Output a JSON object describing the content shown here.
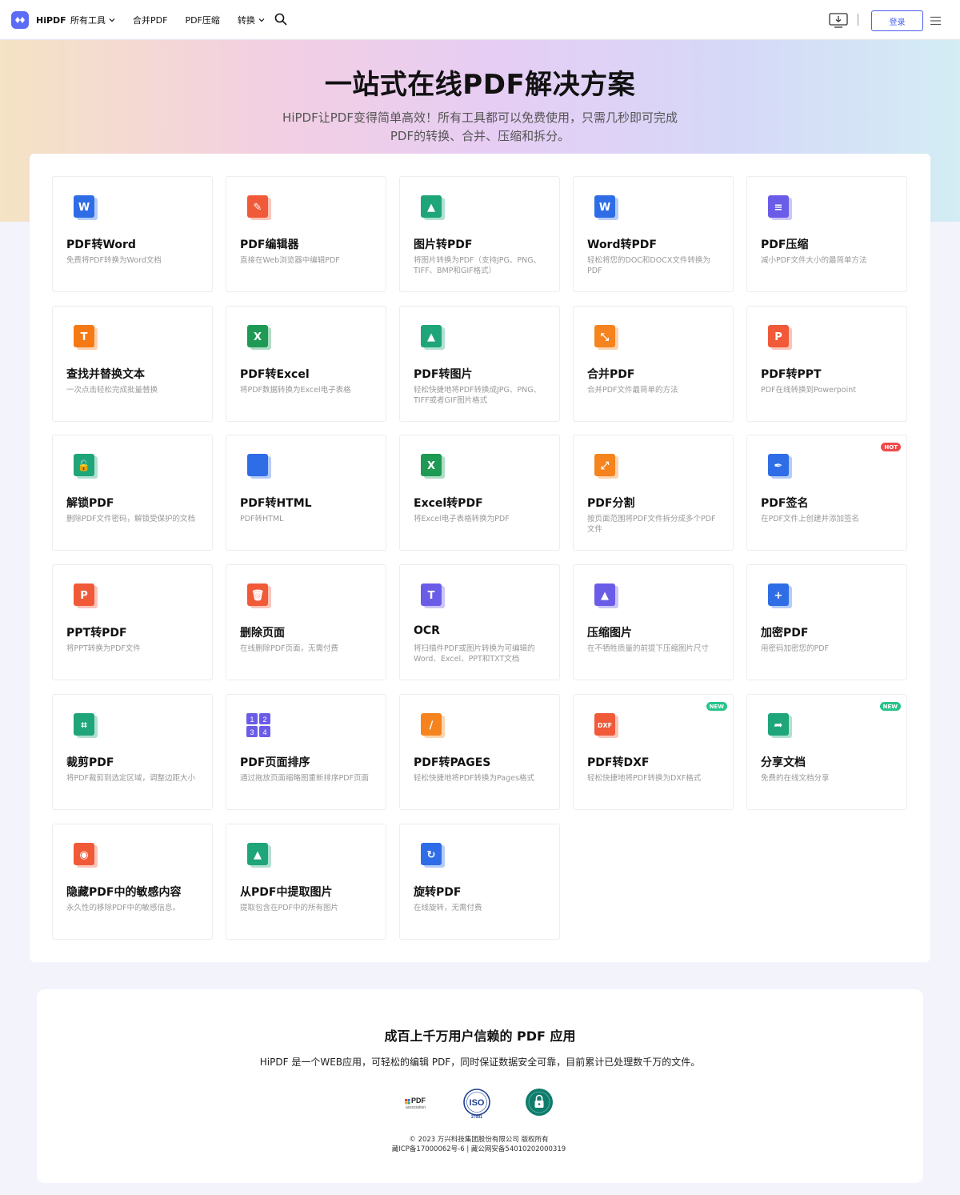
{
  "header": {
    "brand": "HiPDF",
    "nav": [
      {
        "label": "所有工具",
        "dropdown": true
      },
      {
        "label": "合并PDF",
        "dropdown": false
      },
      {
        "label": "PDF压缩",
        "dropdown": false
      },
      {
        "label": "转换",
        "dropdown": true
      }
    ],
    "login_label": "登录"
  },
  "hero": {
    "title": "一站式在线PDF解决方案",
    "subtitle_line1": "HiPDF让PDF变得简单高效！所有工具都可以免费使用，只需几秒即可完成",
    "subtitle_line2": "PDF的转换、合并、压缩和拆分。"
  },
  "tools": [
    {
      "title": "PDF转Word",
      "desc": "免费将PDF转换为Word文档",
      "icon": "pdf-to-word-icon",
      "color": "#2f6de6",
      "glyph": "W",
      "badge": ""
    },
    {
      "title": "PDF编辑器",
      "desc": "直接在Web浏览器中编辑PDF",
      "icon": "pdf-editor-icon",
      "color": "#f05a38",
      "glyph": "✎",
      "badge": ""
    },
    {
      "title": "图片转PDF",
      "desc": "将图片转换为PDF（支持JPG、PNG、TIFF、BMP和GIF格式）",
      "icon": "image-to-pdf-icon",
      "color": "#1fa57a",
      "glyph": "▲",
      "badge": ""
    },
    {
      "title": "Word转PDF",
      "desc": "轻松将您的DOC和DOCX文件转换为PDF",
      "icon": "word-to-pdf-icon",
      "color": "#2f6de6",
      "glyph": "W",
      "badge": ""
    },
    {
      "title": "PDF压缩",
      "desc": "减小PDF文件大小的最简单方法",
      "icon": "compress-pdf-icon",
      "color": "#6b5ce8",
      "glyph": "≡",
      "badge": ""
    },
    {
      "title": "查找并替换文本",
      "desc": "一次点击轻松完成批量替换",
      "icon": "find-replace-icon",
      "color": "#f57a16",
      "glyph": "T",
      "badge": ""
    },
    {
      "title": "PDF转Excel",
      "desc": "将PDF数据转换为Excel电子表格",
      "icon": "pdf-to-excel-icon",
      "color": "#1e9a55",
      "glyph": "X",
      "badge": ""
    },
    {
      "title": "PDF转图片",
      "desc": "轻松快捷地将PDF转换成JPG、PNG、TIFF或者GIF图片格式",
      "icon": "pdf-to-image-icon",
      "color": "#1fa57a",
      "glyph": "▲",
      "badge": ""
    },
    {
      "title": "合并PDF",
      "desc": "合并PDF文件最简单的方法",
      "icon": "merge-pdf-icon",
      "color": "#f5841e",
      "glyph": "⤡",
      "badge": ""
    },
    {
      "title": "PDF转PPT",
      "desc": "PDF在线转换到Powerpoint",
      "icon": "pdf-to-ppt-icon",
      "color": "#f05a38",
      "glyph": "P",
      "badge": ""
    },
    {
      "title": "解锁PDF",
      "desc": "删除PDF文件密码，解锁受保护的文档",
      "icon": "unlock-pdf-icon",
      "color": "#1fa57a",
      "glyph": "🔓",
      "badge": ""
    },
    {
      "title": "PDF转HTML",
      "desc": "PDF转HTML",
      "icon": "pdf-to-html-icon",
      "color": "#2f6de6",
      "glyph": "</>",
      "badge": ""
    },
    {
      "title": "Excel转PDF",
      "desc": "将Excel电子表格转换为PDF",
      "icon": "excel-to-pdf-icon",
      "color": "#1e9a55",
      "glyph": "X",
      "badge": ""
    },
    {
      "title": "PDF分割",
      "desc": "按页面范围将PDF文件拆分成多个PDF文件",
      "icon": "split-pdf-icon",
      "color": "#f5841e",
      "glyph": "⤢",
      "badge": ""
    },
    {
      "title": "PDF签名",
      "desc": "在PDF文件上创建并添加签名",
      "icon": "sign-pdf-icon",
      "color": "#2f6de6",
      "glyph": "✒",
      "badge": "HOT"
    },
    {
      "title": "PPT转PDF",
      "desc": "将PPT转换为PDF文件",
      "icon": "ppt-to-pdf-icon",
      "color": "#f05a38",
      "glyph": "P",
      "badge": ""
    },
    {
      "title": "删除页面",
      "desc": "在线删除PDF页面，无需付费",
      "icon": "delete-pages-icon",
      "color": "#f05a38",
      "glyph": "🗑",
      "badge": ""
    },
    {
      "title": "OCR",
      "desc": "将扫描件PDF或图片转换为可编辑的Word、Excel、PPT和TXT文档",
      "icon": "ocr-icon",
      "color": "#6b5ce8",
      "glyph": "T",
      "badge": ""
    },
    {
      "title": "压缩图片",
      "desc": "在不牺牲质量的前提下压缩图片尺寸",
      "icon": "compress-image-icon",
      "color": "#6b5ce8",
      "glyph": "▲",
      "badge": ""
    },
    {
      "title": "加密PDF",
      "desc": "用密码加密您的PDF",
      "icon": "protect-pdf-icon",
      "color": "#2f6de6",
      "glyph": "+",
      "badge": ""
    },
    {
      "title": "裁剪PDF",
      "desc": "将PDF裁剪到选定区域，调整边距大小",
      "icon": "crop-pdf-icon",
      "color": "#1fa57a",
      "glyph": "⌗",
      "badge": ""
    },
    {
      "title": "PDF页面排序",
      "desc": "通过拖放页面缩略图重新排序PDF页面",
      "icon": "organize-pages-icon",
      "color": "#6b5ce8",
      "glyph": "1234",
      "badge": ""
    },
    {
      "title": "PDF转PAGES",
      "desc": "轻松快捷地将PDF转换为Pages格式",
      "icon": "pdf-to-pages-icon",
      "color": "#f5841e",
      "glyph": "∕",
      "badge": ""
    },
    {
      "title": "PDF转DXF",
      "desc": "轻松快捷地将PDF转换为DXF格式",
      "icon": "pdf-to-dxf-icon",
      "color": "#f05a38",
      "glyph": "DXF",
      "badge": "NEW"
    },
    {
      "title": "分享文档",
      "desc": "免费的在线文档分享",
      "icon": "share-document-icon",
      "color": "#1fa57a",
      "glyph": "➦",
      "badge": "NEW"
    },
    {
      "title": "隐藏PDF中的敏感内容",
      "desc": "永久性的移除PDF中的敏感信息。",
      "icon": "redact-pdf-icon",
      "color": "#f05a38",
      "glyph": "◉",
      "badge": ""
    },
    {
      "title": "从PDF中提取图片",
      "desc": "提取包含在PDF中的所有图片",
      "icon": "extract-images-icon",
      "color": "#1fa57a",
      "glyph": "▲",
      "badge": ""
    },
    {
      "title": "旋转PDF",
      "desc": "在线旋转，无需付费",
      "icon": "rotate-pdf-icon",
      "color": "#2f6de6",
      "glyph": "↻",
      "badge": ""
    }
  ],
  "trust": {
    "title": "成百上千万用户信赖的 PDF 应用",
    "description": "HiPDF 是一个WEB应用，可轻松的编辑 PDF，同时保证数据安全可靠，目前累计已处理数千万的文件。",
    "cert_pdf_top": "PDF",
    "cert_pdf_bottom": "association",
    "cert_iso": "ISO",
    "cert_iso_num": "27001",
    "copyright": "© 2023 万兴科技集团股份有限公司 版权所有",
    "icp": "藏ICP备17000062号-6 | 藏公网安备54010202000319"
  }
}
